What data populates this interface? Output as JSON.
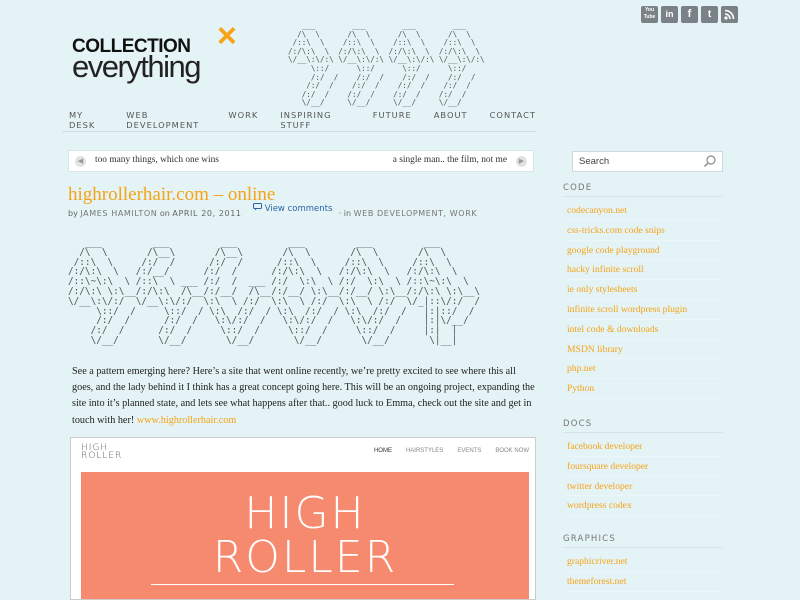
{
  "brand": {
    "line1": "COLLECTION",
    "mark": "×",
    "line2": "everything"
  },
  "header_ascii": "   ___        ___        ___        ___\n  /\\  \\      /\\  \\      /\\  \\      /\\  \\\n /::\\  \\    /::\\  \\    /::\\  \\    /::\\  \\\n/:/\\:\\  \\  /:/\\:\\  \\  /:/\\:\\  \\  /:/\\:\\  \\\n\\/__\\:\\/:\\ \\/__\\:\\/:\\ \\/__\\:\\/:\\ \\/__\\:\\/:\\\n     \\::/      \\::/      \\::/      \\::/\n     /:/  /    /:/  /    /:/  /    /:/  /\n    /:/  /    /:/  /    /:/  /    /:/  /\n   /:/  /    /:/  /    /:/  /    /:/  /\n   \\/__/     \\/__/     \\/__/     \\/__/",
  "social": [
    {
      "icon": "youtube-icon",
      "label": "You Tube"
    },
    {
      "icon": "linkedin-icon",
      "label": "in"
    },
    {
      "icon": "facebook-icon",
      "label": "f"
    },
    {
      "icon": "twitter-icon",
      "label": "t"
    },
    {
      "icon": "rss-icon",
      "label": "rss"
    }
  ],
  "nav": [
    "MY DESK",
    "WEB DEVELOPMENT",
    "WORK",
    "INSPIRING STUFF",
    "FUTURE",
    "ABOUT",
    "CONTACT"
  ],
  "ticker": {
    "prev_label": "too many things, which one wins",
    "next_label": "a single man.. the film, not me"
  },
  "search": {
    "placeholder": "Search"
  },
  "post": {
    "title": "highrollerhair.com – online",
    "by": "by",
    "author": "JAMES HAMILTON",
    "on": "on",
    "date": "APRIL 20, 2011",
    "comments": "View comments",
    "in_text": "· in",
    "categories": "WEB DEVELOPMENT, WORK",
    "ascii_art": "   ___         ___         ___         ___         ___         ___\n  /\\  \\       /\\__\\       /\\__\\       /\\  \\       /\\  \\       /\\  \\\n /::\\  \\     /:/  /      /:/  /      /::\\  \\     /::\\  \\     /::\\  \\\n/:/\\:\\  \\   /:/__/      /:/  /      /:/\\:\\  \\   /:/\\:\\  \\   /:/\\:\\  \\\n/::\\~\\:\\  \\ /::\\  \\ ___ /:/  /  ___ /:/  \\:\\  \\ /:/  \\:\\  \\ /::\\~\\:\\  \\\n/:/\\:\\ \\:\\__/:/\\:\\  /\\__/:/__/  /\\__/:/__/ \\:\\__/:/__/ \\:\\__/:/\\:\\ \\:\\__\\\n\\/__\\:\\/:/  \\/__\\:\\/:/  \\:\\  \\ /:/  \\:\\  \\ /:/  \\:\\  \\ /:/  \\/_|::\\/:/  /\n     \\::/  /     \\::/  / \\:\\  /:/  / \\:\\  /:/  / \\:\\  /:/  /   |:|::/  /\n     /:/  /      /:/  /   \\:\\/:/  /   \\:\\/:/  /   \\:\\/:/  /    |:|\\/__/\n    /:/  /      /:/  /     \\::/  /     \\::/  /     \\::/  /     |:|  |\n    \\/__/       \\/__/       \\/__/       \\/__/       \\/__/       \\|__|",
    "body": "See a pattern emerging here? Here’s a site that went online recently, we’re pretty excited to see where this all goes, and the lady behind it I think has a great concept going here. This will be an ongoing project, expanding the site into it’s planned state, and lets see what happens after that.. good luck to Emma, check out the site and get in touch with her!",
    "link_text": "www.highrollerhair.com"
  },
  "screenshot": {
    "brand_line1": "HIGH",
    "brand_line2": "ROLLER",
    "nav": [
      "HOME",
      "HAIRSTYLES",
      "EVENTS",
      "BOOK NOW"
    ],
    "hero_line1": "HIGH",
    "hero_line2": "ROLLER",
    "hero_color": "#f68a6e"
  },
  "sidebar": {
    "sections": [
      {
        "heading": "CODE",
        "links": [
          "codecanyon.net",
          "css-tricks.com code snips",
          "google code playground",
          "hacky infinite scroll",
          "ie only stylesheets",
          "infinite scroll wordpress plugin",
          "intel code & downloads",
          "MSDN library",
          "php.net",
          "Python"
        ]
      },
      {
        "heading": "DOCS",
        "links": [
          "facebook developer",
          "foursquare developer",
          "twitter developer",
          "wordpress codex"
        ]
      },
      {
        "heading": "GRAPHICS",
        "links": [
          "graphicriver.net",
          "themeforest.net"
        ]
      }
    ]
  },
  "colors": {
    "accent": "#f6a316",
    "background": "#e4f3f6",
    "link_blue": "#2a64a8"
  }
}
